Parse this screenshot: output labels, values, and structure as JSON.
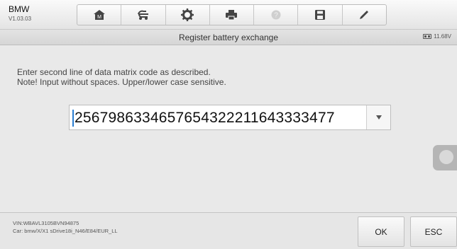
{
  "header": {
    "make": "BMW",
    "version": "V1.03.03",
    "toolbar": [
      {
        "icon": "home-icon"
      },
      {
        "icon": "vehicle-swap-icon"
      },
      {
        "icon": "gear-icon"
      },
      {
        "icon": "printer-icon"
      },
      {
        "icon": "help-icon"
      },
      {
        "icon": "save-icon"
      },
      {
        "icon": "pen-icon"
      }
    ]
  },
  "titlebar": {
    "title": "Register battery exchange",
    "battery_voltage": "11.68V"
  },
  "main": {
    "instruction_line1": "Enter second line of data matrix code as described.",
    "instruction_line2": "Note! Input without spaces. Upper/lower case sensitive.",
    "code_value": "2567986334657654322211643333477"
  },
  "footer": {
    "vin": "VIN:WBAVL3105BVN94875",
    "car": "Car: bmw/X/X1 sDrive18i_N46/E84/EUR_LL",
    "ok_label": "OK",
    "esc_label": "ESC"
  },
  "colors": {
    "accent": "#2a7dd1",
    "background": "#e9e9e9"
  }
}
